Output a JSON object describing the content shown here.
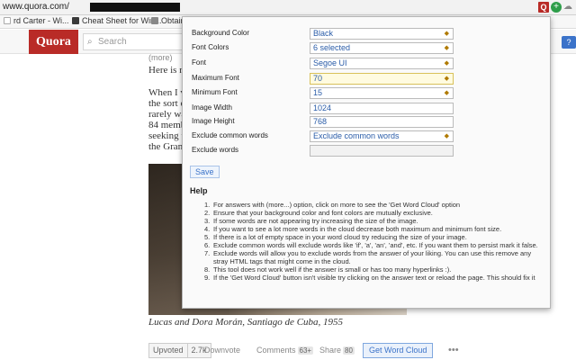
{
  "browser": {
    "url_text": "www.quora.com/",
    "extension_q": "Q",
    "extension_plus": "+",
    "bookmarks": [
      {
        "label": "rd Carter - Wi...",
        "color": "#ffffff"
      },
      {
        "label": "Cheat Sheet for Win...",
        "color": "#3a3a3a"
      },
      {
        "label": "Obtain",
        "color": "#888888"
      }
    ]
  },
  "header": {
    "logo": "Quora",
    "search_placeholder": "Search",
    "help_btn": "?"
  },
  "answer": {
    "more": "(more)",
    "lines": [
      "Here is n",
      "When I v",
      "the sort o",
      "rarely wa",
      "84 memb",
      "seeking t",
      "the Gran"
    ],
    "caption": "Lucas and Dora Morán, Santiago de Cuba, 1955"
  },
  "actions": {
    "upvoted": "Upvoted",
    "upvote_count": "2.7k",
    "downvote": "Downvote",
    "comments": "Comments",
    "comments_count": "63+",
    "share": "Share",
    "share_count": "80",
    "get_word_cloud": "Get Word Cloud",
    "more_dots": "•••"
  },
  "popup": {
    "fields": {
      "background_color": {
        "label": "Background Color",
        "value": "Black"
      },
      "font_colors": {
        "label": "Font Colors",
        "value": "6 selected"
      },
      "font": {
        "label": "Font",
        "value": "Segoe UI"
      },
      "maximum_font": {
        "label": "Maximum Font",
        "value": "70"
      },
      "minimum_font": {
        "label": "Minimum Font",
        "value": "15"
      },
      "image_width": {
        "label": "Image Width",
        "value": "1024"
      },
      "image_height": {
        "label": "Image Height",
        "value": "768"
      },
      "exclude_common": {
        "label": "Exclude common words",
        "value": "Exclude common words"
      },
      "exclude_words": {
        "label": "Exclude words",
        "value": ""
      }
    },
    "save_label": "Save",
    "help_title": "Help",
    "help_items": [
      "For answers with (more...) option, click on more to see the 'Get Word Cloud' option",
      "Ensure that your background color and font colors are mutually exclusive.",
      "If some words are not appearing try increasing the size of the image.",
      "If you want to see a lot more words in the cloud decrease both maximum and minimum font size.",
      "If there is a lot of empty space in your word cloud try reducing the size of your image.",
      "Exclude common words will exclude words like 'if', 'a', 'an', 'and', etc. If you want them to persist mark it false.",
      "Exclude words will allow you to exclude words from the answer of your liking. You can use this remove any stray HTML tags that might come in the cloud.",
      "This tool does not work well if the answer is small or has too many hyperlinks :).",
      "If the 'Get Word Cloud' button isn't visible try clicking on the answer text or reload the page. This should fix it"
    ]
  }
}
